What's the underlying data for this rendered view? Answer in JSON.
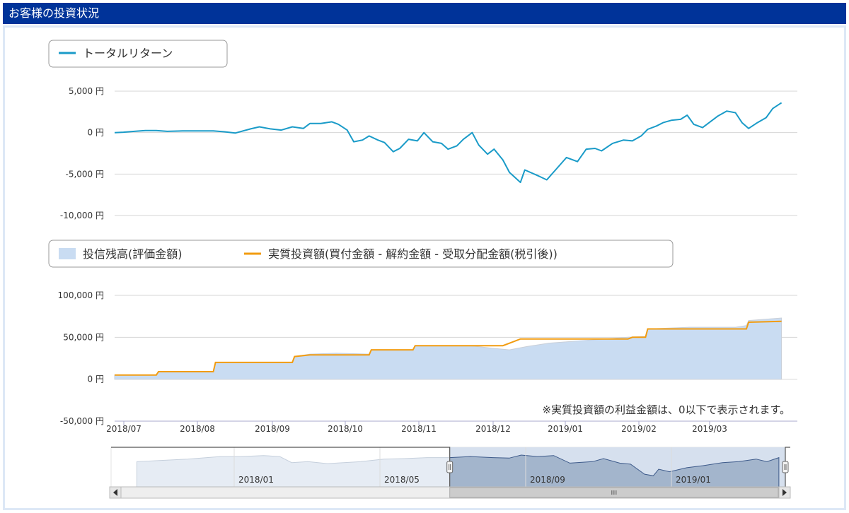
{
  "header": {
    "title": "お客様の投資状況"
  },
  "legend_top": {
    "items": [
      {
        "label": "トータルリターン",
        "color": "#1a9bc8"
      }
    ]
  },
  "legend_bottom": {
    "items": [
      {
        "label": "投信残高(評価金額)",
        "color": "#c9dcf2"
      },
      {
        "label": "実質投資額(買付金額 - 解約金額 - 受取分配金額(税引後))",
        "color": "#f29c10"
      }
    ]
  },
  "note": "※実質投資額の利益金額は、0以下で表示されます。",
  "chart_data": [
    {
      "type": "line",
      "series": [
        {
          "name": "トータルリターン",
          "color": "#1a9bc8",
          "points": [
            [
              "2018-07-01",
              0
            ],
            [
              "2018-07-05",
              50
            ],
            [
              "2018-07-10",
              150
            ],
            [
              "2018-07-15",
              250
            ],
            [
              "2018-07-20",
              250
            ],
            [
              "2018-07-25",
              150
            ],
            [
              "2018-08-01",
              200
            ],
            [
              "2018-08-08",
              200
            ],
            [
              "2018-08-15",
              200
            ],
            [
              "2018-08-20",
              100
            ],
            [
              "2018-08-25",
              -50
            ],
            [
              "2018-09-01",
              450
            ],
            [
              "2018-09-05",
              700
            ],
            [
              "2018-09-10",
              450
            ],
            [
              "2018-09-15",
              300
            ],
            [
              "2018-09-20",
              700
            ],
            [
              "2018-09-25",
              500
            ],
            [
              "2018-09-28",
              1100
            ],
            [
              "2018-10-03",
              1100
            ],
            [
              "2018-10-08",
              1300
            ],
            [
              "2018-10-11",
              1000
            ],
            [
              "2018-10-15",
              300
            ],
            [
              "2018-10-18",
              -1100
            ],
            [
              "2018-10-22",
              -900
            ],
            [
              "2018-10-25",
              -400
            ],
            [
              "2018-10-29",
              -900
            ],
            [
              "2018-11-01",
              -1200
            ],
            [
              "2018-11-05",
              -2300
            ],
            [
              "2018-11-08",
              -1900
            ],
            [
              "2018-11-12",
              -800
            ],
            [
              "2018-11-16",
              -1000
            ],
            [
              "2018-11-19",
              0
            ],
            [
              "2018-11-23",
              -1100
            ],
            [
              "2018-11-27",
              -1300
            ],
            [
              "2018-11-30",
              -2000
            ],
            [
              "2018-12-04",
              -1600
            ],
            [
              "2018-12-07",
              -800
            ],
            [
              "2018-12-11",
              0
            ],
            [
              "2018-12-14",
              -1500
            ],
            [
              "2018-12-18",
              -2600
            ],
            [
              "2018-12-21",
              -2000
            ],
            [
              "2018-12-25",
              -3300
            ],
            [
              "2018-12-28",
              -4800
            ],
            [
              "2019-01-02",
              -6000
            ],
            [
              "2019-01-04",
              -4500
            ],
            [
              "2019-01-10",
              -5200
            ],
            [
              "2019-01-14",
              -5700
            ],
            [
              "2019-01-18",
              -4500
            ],
            [
              "2019-01-23",
              -3000
            ],
            [
              "2019-01-28",
              -3500
            ],
            [
              "2019-02-01",
              -2000
            ],
            [
              "2019-02-05",
              -1900
            ],
            [
              "2019-02-08",
              -2200
            ],
            [
              "2019-02-13",
              -1300
            ],
            [
              "2019-02-18",
              -900
            ],
            [
              "2019-02-22",
              -1000
            ],
            [
              "2019-02-26",
              -400
            ],
            [
              "2019-03-01",
              400
            ],
            [
              "2019-03-05",
              800
            ],
            [
              "2019-03-08",
              1200
            ],
            [
              "2019-03-12",
              1500
            ],
            [
              "2019-03-16",
              1600
            ],
            [
              "2019-03-19",
              2100
            ],
            [
              "2019-03-22",
              1000
            ],
            [
              "2019-03-26",
              600
            ],
            [
              "2019-03-29",
              1200
            ],
            [
              "2019-04-02",
              2000
            ],
            [
              "2019-04-06",
              2600
            ],
            [
              "2019-04-10",
              2400
            ],
            [
              "2019-04-13",
              1200
            ],
            [
              "2019-04-16",
              500
            ],
            [
              "2019-04-20",
              1200
            ],
            [
              "2019-04-24",
              1800
            ],
            [
              "2019-04-27",
              2900
            ],
            [
              "2019-05-01",
              3600
            ]
          ]
        }
      ],
      "x_ticks": [],
      "y_ticks": [
        {
          "value": 5000,
          "label": "5,000 円"
        },
        {
          "value": 0,
          "label": "0 円"
        },
        {
          "value": -5000,
          "label": "-5,000 円"
        },
        {
          "value": -10000,
          "label": "-10,000 円"
        }
      ],
      "ylim": [
        -10000,
        5000
      ],
      "xlim": [
        "2018-07-01",
        "2019-05-05"
      ],
      "grid": true
    },
    {
      "type": "area",
      "series": [
        {
          "name": "投信残高(評価金額)",
          "color": "#c9dcf2",
          "kind": "area",
          "points": [
            [
              "2018-07-01",
              5000
            ],
            [
              "2018-07-20",
              5000
            ],
            [
              "2018-07-21",
              9000
            ],
            [
              "2018-08-15",
              9000
            ],
            [
              "2018-08-16",
              20000
            ],
            [
              "2018-09-20",
              20000
            ],
            [
              "2018-09-21",
              27000
            ],
            [
              "2018-09-28",
              30000
            ],
            [
              "2018-10-10",
              31000
            ],
            [
              "2018-10-25",
              30000
            ],
            [
              "2018-10-26",
              35000
            ],
            [
              "2018-11-14",
              35000
            ],
            [
              "2018-11-15",
              40000
            ],
            [
              "2018-12-10",
              40000
            ],
            [
              "2018-12-20",
              37000
            ],
            [
              "2018-12-28",
              35000
            ],
            [
              "2019-01-05",
              39000
            ],
            [
              "2019-01-15",
              43000
            ],
            [
              "2019-01-30",
              46000
            ],
            [
              "2019-02-10",
              48000
            ],
            [
              "2019-02-20",
              50000
            ],
            [
              "2019-02-28",
              51000
            ],
            [
              "2019-03-01",
              60000
            ],
            [
              "2019-03-20",
              62000
            ],
            [
              "2019-04-10",
              62000
            ],
            [
              "2019-04-15",
              64000
            ],
            [
              "2019-04-16",
              70000
            ],
            [
              "2019-05-01",
              73000
            ]
          ]
        },
        {
          "name": "実質投資額(買付金額 - 解約金額 - 受取分配金額(税引後))",
          "color": "#f29c10",
          "kind": "step",
          "points": [
            [
              "2018-07-01",
              5000
            ],
            [
              "2018-07-20",
              5000
            ],
            [
              "2018-07-21",
              9000
            ],
            [
              "2018-08-15",
              9000
            ],
            [
              "2018-08-16",
              20000
            ],
            [
              "2018-09-20",
              20000
            ],
            [
              "2018-09-21",
              27000
            ],
            [
              "2018-09-28",
              29000
            ],
            [
              "2018-10-25",
              29000
            ],
            [
              "2018-10-26",
              35000
            ],
            [
              "2018-11-14",
              35000
            ],
            [
              "2018-11-15",
              40000
            ],
            [
              "2018-12-25",
              40000
            ],
            [
              "2018-12-30",
              45000
            ],
            [
              "2019-01-02",
              48000
            ],
            [
              "2019-02-20",
              48000
            ],
            [
              "2019-02-22",
              50000
            ],
            [
              "2019-02-28",
              50000
            ],
            [
              "2019-03-01",
              60000
            ],
            [
              "2019-04-15",
              60000
            ],
            [
              "2019-04-16",
              68000
            ],
            [
              "2019-05-01",
              69000
            ]
          ]
        }
      ],
      "x_ticks": [
        "2018/07",
        "2018/08",
        "2018/09",
        "2018/10",
        "2018/11",
        "2018/12",
        "2019/01",
        "2019/02",
        "2019/03"
      ],
      "y_ticks": [
        {
          "value": 100000,
          "label": "100,000 円"
        },
        {
          "value": 50000,
          "label": "50,000 円"
        },
        {
          "value": 0,
          "label": "0 円"
        },
        {
          "value": -50000,
          "label": "-50,000 円"
        }
      ],
      "ylim": [
        -50000,
        100000
      ],
      "xlim": [
        "2018-07-01",
        "2019-05-05"
      ],
      "grid": true
    },
    {
      "type": "area",
      "navigator": true,
      "x_ticks": [
        "2018/01",
        "2018/05",
        "2018/09",
        "2019/01"
      ],
      "xlim": [
        "2017-09-01",
        "2019-05-05"
      ],
      "selected_range": [
        "2018-07-01",
        "2019-05-05"
      ],
      "series": [
        {
          "name": "",
          "points": [
            [
              "2017-09-15",
              50
            ],
            [
              "2017-11-01",
              55
            ],
            [
              "2017-12-01",
              60
            ],
            [
              "2017-12-20",
              60
            ],
            [
              "2018-01-10",
              62
            ],
            [
              "2018-01-25",
              60
            ],
            [
              "2018-02-05",
              48
            ],
            [
              "2018-02-20",
              50
            ],
            [
              "2018-03-10",
              46
            ],
            [
              "2018-03-25",
              48
            ],
            [
              "2018-04-10",
              50
            ],
            [
              "2018-05-01",
              55
            ],
            [
              "2018-05-20",
              56
            ],
            [
              "2018-06-10",
              58
            ],
            [
              "2018-07-01",
              58
            ],
            [
              "2018-07-20",
              60
            ],
            [
              "2018-08-10",
              58
            ],
            [
              "2018-08-25",
              57
            ],
            [
              "2018-09-05",
              63
            ],
            [
              "2018-09-20",
              60
            ],
            [
              "2018-10-05",
              62
            ],
            [
              "2018-10-20",
              47
            ],
            [
              "2018-11-10",
              50
            ],
            [
              "2018-11-20",
              56
            ],
            [
              "2018-12-05",
              47
            ],
            [
              "2018-12-15",
              45
            ],
            [
              "2018-12-28",
              25
            ],
            [
              "2019-01-05",
              22
            ],
            [
              "2019-01-10",
              35
            ],
            [
              "2019-01-20",
              30
            ],
            [
              "2019-02-05",
              38
            ],
            [
              "2019-02-20",
              42
            ],
            [
              "2019-03-10",
              48
            ],
            [
              "2019-03-25",
              50
            ],
            [
              "2019-04-10",
              55
            ],
            [
              "2019-04-20",
              50
            ],
            [
              "2019-05-01",
              58
            ]
          ]
        }
      ]
    }
  ]
}
